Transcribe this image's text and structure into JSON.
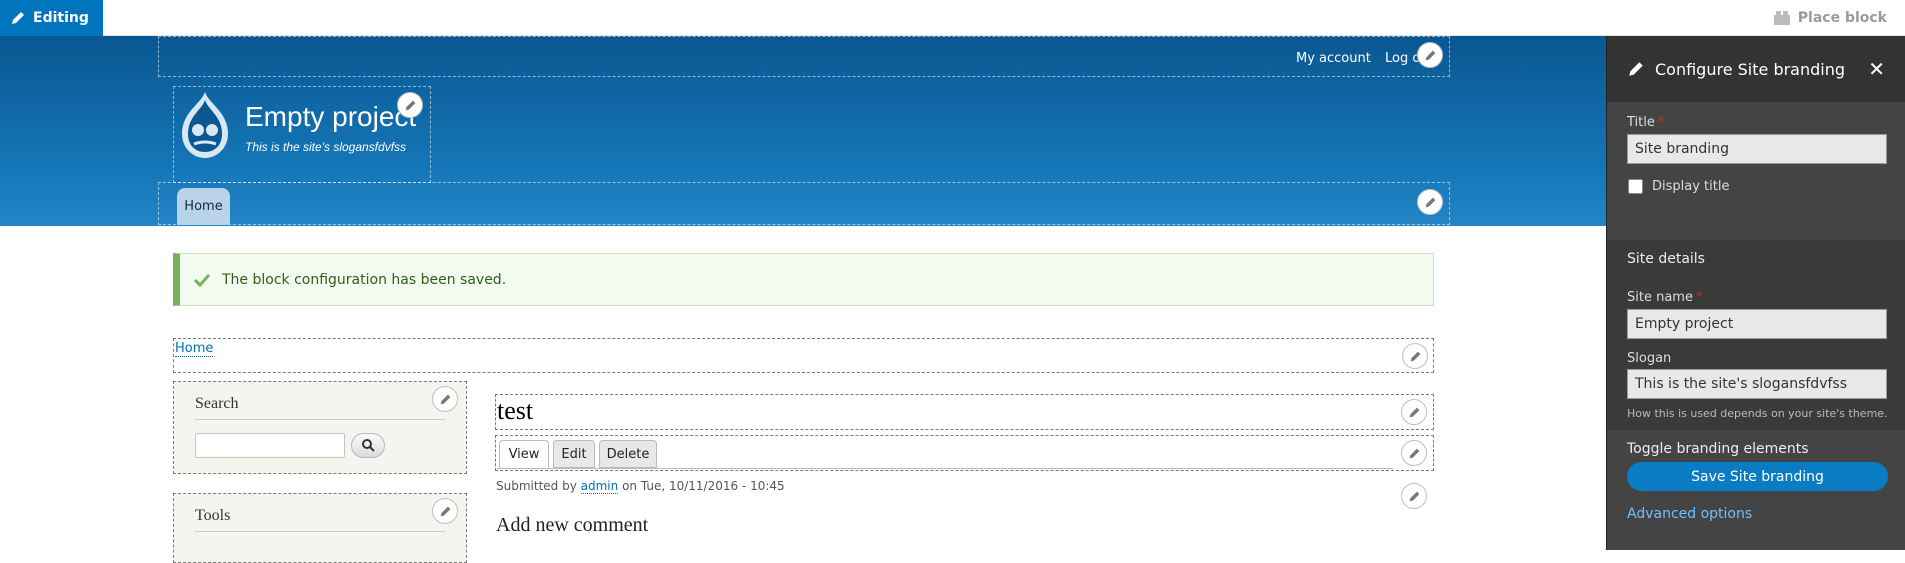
{
  "toolbar": {
    "edit_label": "Editing",
    "place_block_label": "Place block"
  },
  "header": {
    "secondary_nav": [
      "My account",
      "Log out"
    ],
    "site_name": "Empty project",
    "slogan": "This is the site's slogansfdvfss",
    "main_nav": [
      "Home"
    ]
  },
  "status_message": "The block configuration has been saved.",
  "breadcrumb": [
    "Home"
  ],
  "sidebar": {
    "search_title": "Search",
    "search_placeholder": "",
    "tools_title": "Tools"
  },
  "content": {
    "title": "test",
    "tabs": [
      "View",
      "Edit",
      "Delete"
    ],
    "submitted_prefix": "Submitted by",
    "author": "admin",
    "submitted_suffix": "on Tue, 10/11/2016 - 10:45",
    "comment_heading": "Add new comment"
  },
  "tray": {
    "title": "Configure Site branding",
    "title_label": "Title",
    "title_value": "Site branding",
    "display_title_label": "Display title",
    "site_details_heading": "Site details",
    "site_name_label": "Site name",
    "site_name_value": "Empty project",
    "slogan_label": "Slogan",
    "slogan_value": "This is the site's slogansfdvfss",
    "slogan_help": "How this is used depends on your site's theme.",
    "toggle_heading": "Toggle branding elements",
    "save_label": "Save Site branding",
    "advanced_label": "Advanced options"
  },
  "colors": {
    "accent": "#0074bd",
    "header_top": "#0a5791",
    "header_bottom": "#2385c6",
    "tray_bg": "#444444",
    "status_border": "#77b259"
  }
}
